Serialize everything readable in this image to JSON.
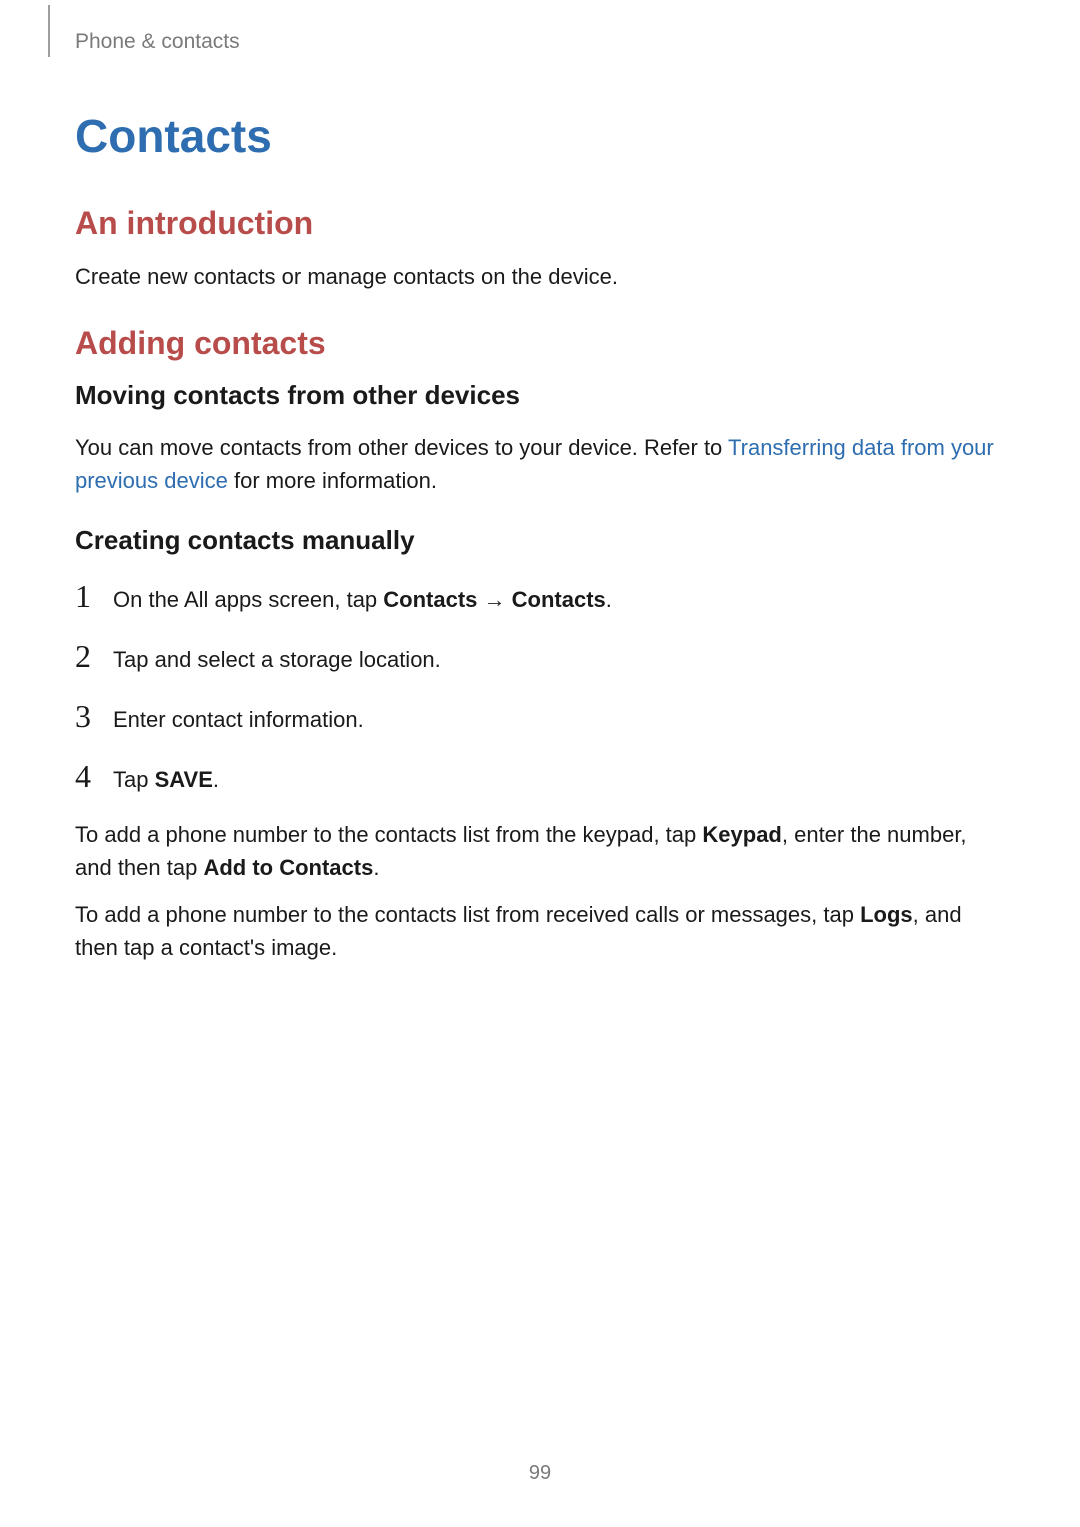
{
  "breadcrumb": "Phone & contacts",
  "title": "Contacts",
  "section_intro": {
    "heading": "An introduction",
    "body": "Create new contacts or manage contacts on the device."
  },
  "section_adding": {
    "heading": "Adding contacts",
    "moving": {
      "heading": "Moving contacts from other devices",
      "body_pre": "You can move contacts from other devices to your device. Refer to ",
      "link": "Transferring data from your previous device",
      "body_post": " for more information."
    },
    "creating": {
      "heading": "Creating contacts manually",
      "steps": {
        "s1": {
          "num": "1",
          "pre": "On the All apps screen, tap ",
          "bold1": "Contacts",
          "arrow": " → ",
          "bold2": "Contacts",
          "post": "."
        },
        "s2": {
          "num": "2",
          "pre": "Tap ",
          "icon_gap": "   ",
          "post": " and select a storage location."
        },
        "s3": {
          "num": "3",
          "text": "Enter contact information."
        },
        "s4": {
          "num": "4",
          "pre": "Tap ",
          "bold": "SAVE",
          "post": "."
        }
      },
      "note1": {
        "pre": "To add a phone number to the contacts list from the keypad, tap ",
        "bold1": "Keypad",
        "mid": ", enter the number, and then tap ",
        "bold2": "Add to Contacts",
        "post": "."
      },
      "note2": {
        "pre": "To add a phone number to the contacts list from received calls or messages, tap ",
        "bold1": "Logs",
        "post": ", and then tap a contact's image."
      }
    }
  },
  "page_number": "99"
}
